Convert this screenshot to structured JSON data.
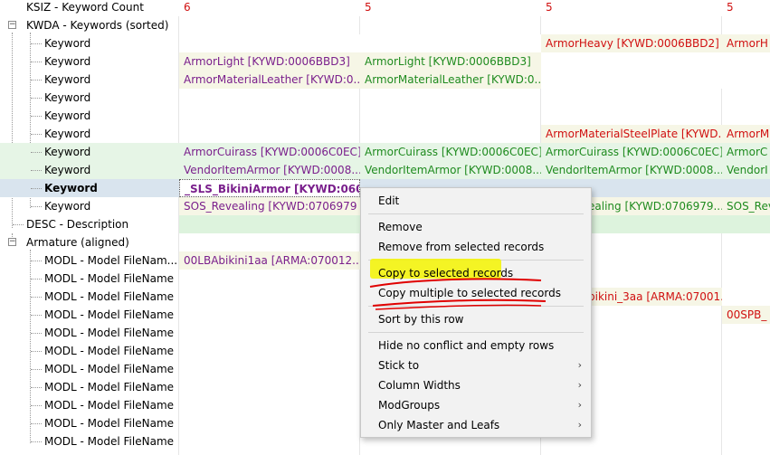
{
  "rows": [
    {
      "label": "KSIZ - Keyword Count",
      "level": 1,
      "c1": "6",
      "c2": "5",
      "c3": "5",
      "c4": "5",
      "color": "red"
    },
    {
      "label": "KWDA - Keywords (sorted)",
      "level": 0,
      "expander": "⊟",
      "c1": "",
      "c2": "",
      "c3": "",
      "c4": "",
      "color": "black"
    },
    {
      "label": "Keyword",
      "level": 2,
      "c1": "",
      "c2": "",
      "c3": "ArmorHeavy [KYWD:0006BBD2]",
      "c4": "ArmorH",
      "color": "red"
    },
    {
      "label": "Keyword",
      "level": 2,
      "c1": "ArmorLight [KYWD:0006BBD3]",
      "c2": "ArmorLight [KYWD:0006BBD3]",
      "c3": "",
      "c4": ""
    },
    {
      "label": "Keyword",
      "level": 2,
      "c1": "ArmorMaterialLeather [KYWD:0...",
      "c2": "ArmorMaterialLeather [KYWD:0...",
      "c3": "",
      "c4": ""
    },
    {
      "label": "Keyword",
      "level": 2,
      "c1": "",
      "c2": "",
      "c3": "",
      "c4": ""
    },
    {
      "label": "Keyword",
      "level": 2,
      "c1": "",
      "c2": "",
      "c3": "",
      "c4": ""
    },
    {
      "label": "Keyword",
      "level": 2,
      "c1": "",
      "c2": "",
      "c3": "ArmorMaterialSteelPlate [KYWD...",
      "c4": "ArmorM"
    },
    {
      "label": "Keyword",
      "level": 2,
      "c1": "ArmorCuirass [KYWD:0006C0EC]",
      "c2": "ArmorCuirass [KYWD:0006C0EC]",
      "c3": "ArmorCuirass [KYWD:0006C0EC]",
      "c4": "ArmorC"
    },
    {
      "label": "Keyword",
      "level": 2,
      "c1": "VendorItemArmor [KYWD:0008...",
      "c2": "VendorItemArmor [KYWD:0008...",
      "c3": "VendorItemArmor [KYWD:0008...",
      "c4": "VendorI"
    },
    {
      "label": "Keyword",
      "level": 2,
      "c1": "_SLS_BikiniArmor [KYWD:0604...",
      "c2": "",
      "c3": "",
      "c4": ""
    },
    {
      "label": "Keyword",
      "level": 2,
      "c1": "SOS_Revealing [KYWD:0706979",
      "c2": "",
      "c3": "ealing [KYWD:0706979...",
      "c4": "SOS_Rev"
    },
    {
      "label": "DESC - Description",
      "level": 1,
      "c1": "",
      "c2": "",
      "c3": "",
      "c4": ""
    },
    {
      "label": "Armature (aligned)",
      "level": 0,
      "expander": "⊟",
      "c1": "",
      "c2": "",
      "c3": "",
      "c4": ""
    },
    {
      "label": "MODL - Model FileNam...",
      "level": 2,
      "c1": "00LBAbikini1aa [ARMA:070012...",
      "c2": "",
      "c3": "",
      "c4": ""
    },
    {
      "label": "MODL - Model FileName",
      "level": 2,
      "c1": "",
      "c2": "",
      "c3": "",
      "c4": ""
    },
    {
      "label": "MODL - Model FileName",
      "level": 2,
      "c1": "",
      "c2": "",
      "c3": "bikini_3aa [ARMA:07001...",
      "c4": ""
    },
    {
      "label": "MODL - Model FileName",
      "level": 2,
      "c1": "",
      "c2": "",
      "c3": "",
      "c4": "00SPB_"
    },
    {
      "label": "MODL - Model FileName",
      "level": 2,
      "c1": "",
      "c2": "",
      "c3": "",
      "c4": ""
    },
    {
      "label": "MODL - Model FileName",
      "level": 2,
      "c1": "",
      "c2": "",
      "c3": "",
      "c4": ""
    },
    {
      "label": "MODL - Model FileName",
      "level": 2,
      "c1": "",
      "c2": "",
      "c3": "",
      "c4": ""
    },
    {
      "label": "MODL - Model FileName",
      "level": 2,
      "c1": "",
      "c2": "",
      "c3": "",
      "c4": ""
    },
    {
      "label": "MODL - Model FileName",
      "level": 2,
      "c1": "",
      "c2": "",
      "c3": "",
      "c4": ""
    },
    {
      "label": "MODL - Model FileName",
      "level": 2,
      "c1": "",
      "c2": "",
      "c3": "",
      "c4": ""
    },
    {
      "label": "MODL - Model FileName",
      "level": 2,
      "c1": "",
      "c2": "",
      "c3": "",
      "c4": ""
    }
  ],
  "menu": {
    "items": [
      {
        "label": "Edit",
        "submenu": false
      },
      {
        "label": "Remove",
        "submenu": false
      },
      {
        "label": "Remove from selected records",
        "submenu": false
      },
      {
        "label": "Copy to selected records",
        "submenu": false
      },
      {
        "label": "Copy multiple to selected records",
        "submenu": false
      },
      {
        "label": "Sort by this row",
        "submenu": false
      },
      {
        "label": "Hide no conflict and empty rows",
        "submenu": false
      },
      {
        "label": "Stick to",
        "submenu": true
      },
      {
        "label": "Column Widths",
        "submenu": true
      },
      {
        "label": "ModGroups",
        "submenu": true
      },
      {
        "label": "Only Master and Leafs",
        "submenu": true
      }
    ]
  },
  "colors": {
    "purple": "#7a1f8c",
    "green": "#1f8b1f",
    "red": "#d01010",
    "highlight": "#f5f500",
    "annotation": "#e00000",
    "selected_row": "#d9e4ee"
  }
}
